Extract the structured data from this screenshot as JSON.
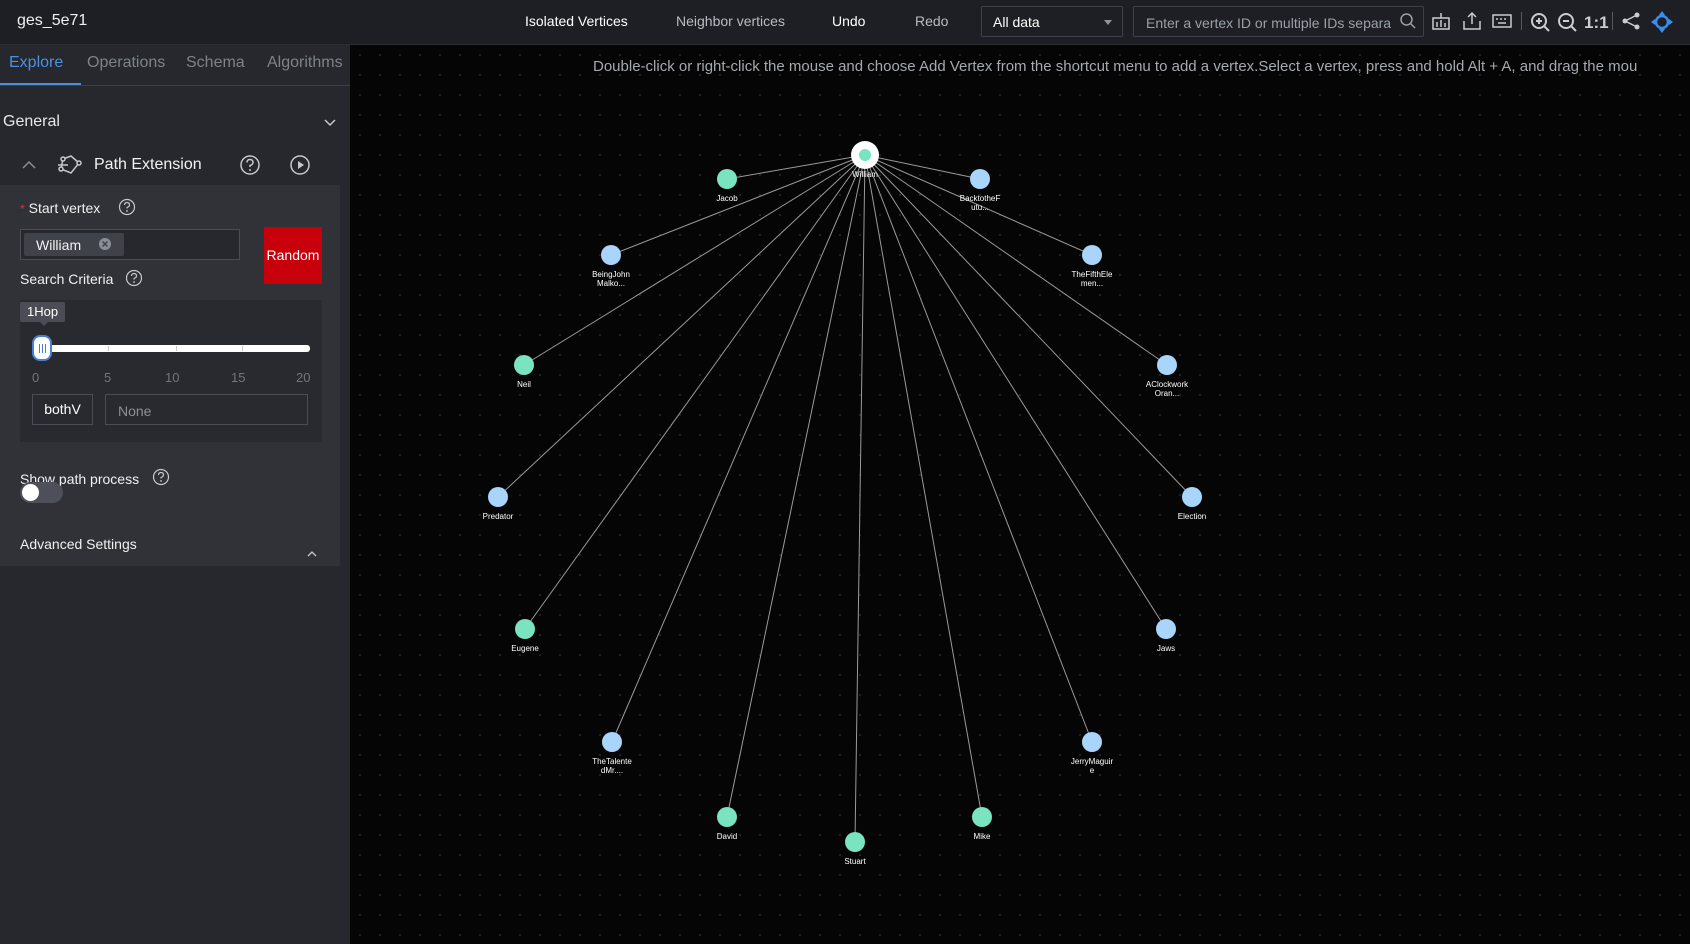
{
  "app": {
    "graph_name": "ges_5e71"
  },
  "toolbar": {
    "isolated_vertices": "Isolated Vertices",
    "neighbor_vertices": "Neighbor vertices",
    "undo": "Undo",
    "redo": "Redo",
    "data_filter": "All data",
    "search_placeholder": "Enter a vertex ID or multiple IDs separat",
    "fit_label": "1:1"
  },
  "tabs": [
    "Explore",
    "Operations",
    "Schema",
    "Algorithms"
  ],
  "panel": {
    "section": "General",
    "algorithm": "Path Extension",
    "start_vertex_label": "Start vertex",
    "start_vertex_value": "William",
    "random_button": "Random",
    "search_criteria_label": "Search Criteria",
    "hop_value_label": "1Hop",
    "hop_value": 1,
    "slider_min": 0,
    "slider_max": 20,
    "slider_ticks": [
      "0",
      "5",
      "10",
      "15",
      "20"
    ],
    "direction": "bothV",
    "label_placeholder": "None",
    "show_path_label": "Show path process",
    "show_path_enabled": false,
    "advanced_settings": "Advanced Settings"
  },
  "canvas": {
    "hint": "Double-click or right-click the mouse and choose Add Vertex from the shortcut menu to add a vertex.Select a vertex, press and hold Alt + A, and drag the mou"
  },
  "graph": {
    "center": {
      "label": "William",
      "color": "#7ae3bf"
    },
    "colors": {
      "person": "#7ae3bf",
      "movie": "#a9d4fb",
      "edge": "#9a9a9a"
    },
    "vertices": [
      {
        "label": "Jacob",
        "lines": [
          "Jacob"
        ],
        "type": "person"
      },
      {
        "label": "BacktotheFutu...",
        "lines": [
          "BacktotheF",
          "utu..."
        ],
        "type": "movie"
      },
      {
        "label": "BeingJohnMalko...",
        "lines": [
          "BeingJohn",
          "Malko..."
        ],
        "type": "movie"
      },
      {
        "label": "TheFifthElemen...",
        "lines": [
          "TheFifthEle",
          "men..."
        ],
        "type": "movie"
      },
      {
        "label": "Neil",
        "lines": [
          "Neil"
        ],
        "type": "person"
      },
      {
        "label": "AClockworkOran...",
        "lines": [
          "AClockwork",
          "Oran..."
        ],
        "type": "movie"
      },
      {
        "label": "Predator",
        "lines": [
          "Predator"
        ],
        "type": "movie"
      },
      {
        "label": "Election",
        "lines": [
          "Election"
        ],
        "type": "movie"
      },
      {
        "label": "Eugene",
        "lines": [
          "Eugene"
        ],
        "type": "person"
      },
      {
        "label": "Jaws",
        "lines": [
          "Jaws"
        ],
        "type": "movie"
      },
      {
        "label": "TheTalentedMr....",
        "lines": [
          "TheTalente",
          "dMr...."
        ],
        "type": "movie"
      },
      {
        "label": "JerryMaguire",
        "lines": [
          "JerryMaguir",
          "e"
        ],
        "type": "movie"
      },
      {
        "label": "David",
        "lines": [
          "David"
        ],
        "type": "person"
      },
      {
        "label": "Mike",
        "lines": [
          "Mike"
        ],
        "type": "person"
      },
      {
        "label": "Stuart",
        "lines": [
          "Stuart"
        ],
        "type": "person"
      }
    ]
  }
}
